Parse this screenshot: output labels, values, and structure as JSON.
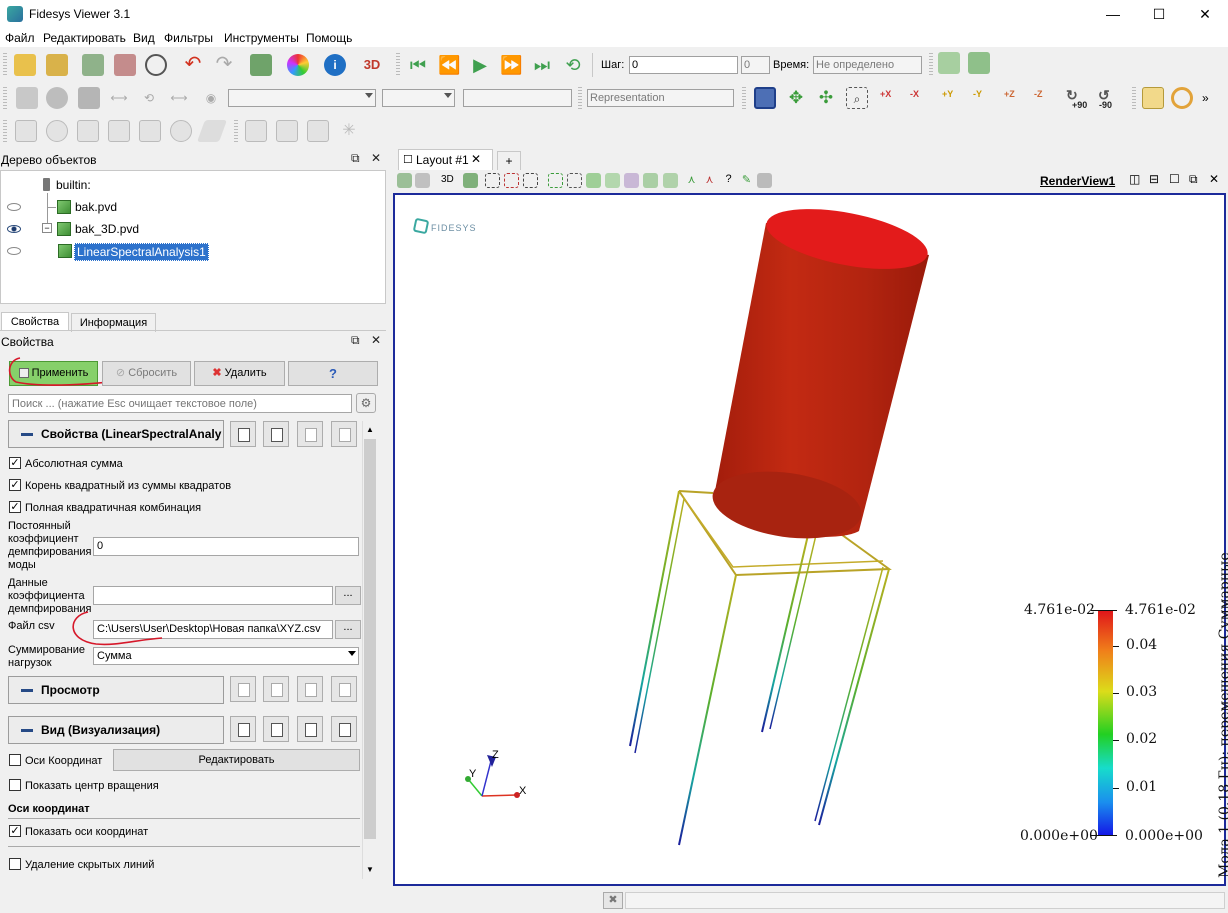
{
  "window": {
    "title": "Fidesys Viewer 3.1",
    "minimize": "—",
    "maximize": "☐",
    "close": "✕"
  },
  "menu": [
    "Файл",
    "Редактировать",
    "Вид",
    "Фильтры",
    "Инструменты",
    "Помощь"
  ],
  "time_toolbar": {
    "step_label": "Шаг:",
    "step_value": "0",
    "step_count": "0",
    "time_label": "Время:",
    "time_value": "Не определено"
  },
  "repr_toolbar": {
    "representation_placeholder": "Representation"
  },
  "camera_buttons": [
    "+X",
    "-X",
    "+Y",
    "-Y",
    "+Z",
    "-Z",
    "+90",
    "-90"
  ],
  "pipeline": {
    "title": "Дерево объектов",
    "items": [
      {
        "label": "builtin:",
        "visible": null
      },
      {
        "label": "bak.pvd",
        "visible": false
      },
      {
        "label": "bak_3D.pvd",
        "visible": true
      },
      {
        "label": "LinearSpectralAnalysis1",
        "visible": false,
        "selected": true
      }
    ]
  },
  "tabs": [
    "Свойства",
    "Информация"
  ],
  "properties": {
    "title": "Свойства",
    "apply": "Применить",
    "reset": "Сбросить",
    "delete": "Удалить",
    "help": "?",
    "search_placeholder": "Поиск ... (нажатие Esc очищает текстовое поле)",
    "section_props": "Свойства (LinearSpectralAnaly",
    "check_abs": "Абсолютная сумма",
    "check_sqrt": "Корень квадратный из суммы квадратов",
    "check_full": "Полная квадратичная комбинация",
    "damping_const_label": "Постоянный коэффициент демпфирования моды",
    "damping_const_value": "0",
    "damping_data_label": "Данные коэффициента демпфирования",
    "damping_data_value": "",
    "csv_label": "Файл csv",
    "csv_value": "C:\\Users\\User\\Desktop\\Новая папка\\XYZ.csv",
    "sum_label": "Суммирование нагрузок",
    "sum_value": "Сумма",
    "browse": "...",
    "section_view": "Просмотр",
    "section_display": "Вид (Визуализация)",
    "axes_check": "Оси Координат",
    "edit_button": "Редактировать",
    "center_check": "Показать центр вращения",
    "axes_group": "Оси координат",
    "show_axes": "Показать оси координат",
    "hidden_lines": "Удаление скрытых линий"
  },
  "layout": {
    "tab": "Layout #1",
    "add": "+",
    "view_name": "RenderView1",
    "toggle_3d": "3D"
  },
  "render": {
    "logo": "FIDESYS",
    "legend": {
      "title": "Мода 1 (0.18 Гц): перемещения Суммарные",
      "max_left": "4.761e-02",
      "max_right": "4.761e-02",
      "min_left": "0.000e+00",
      "min_right": "0.000e+00",
      "ticks": [
        "0.04",
        "0.03",
        "0.02",
        "0.01"
      ],
      "tick_values": [
        0.04,
        0.03,
        0.02,
        0.01
      ],
      "range": [
        0,
        0.04761
      ]
    },
    "axes": {
      "x": "X",
      "y": "Y",
      "z": "Z"
    }
  }
}
